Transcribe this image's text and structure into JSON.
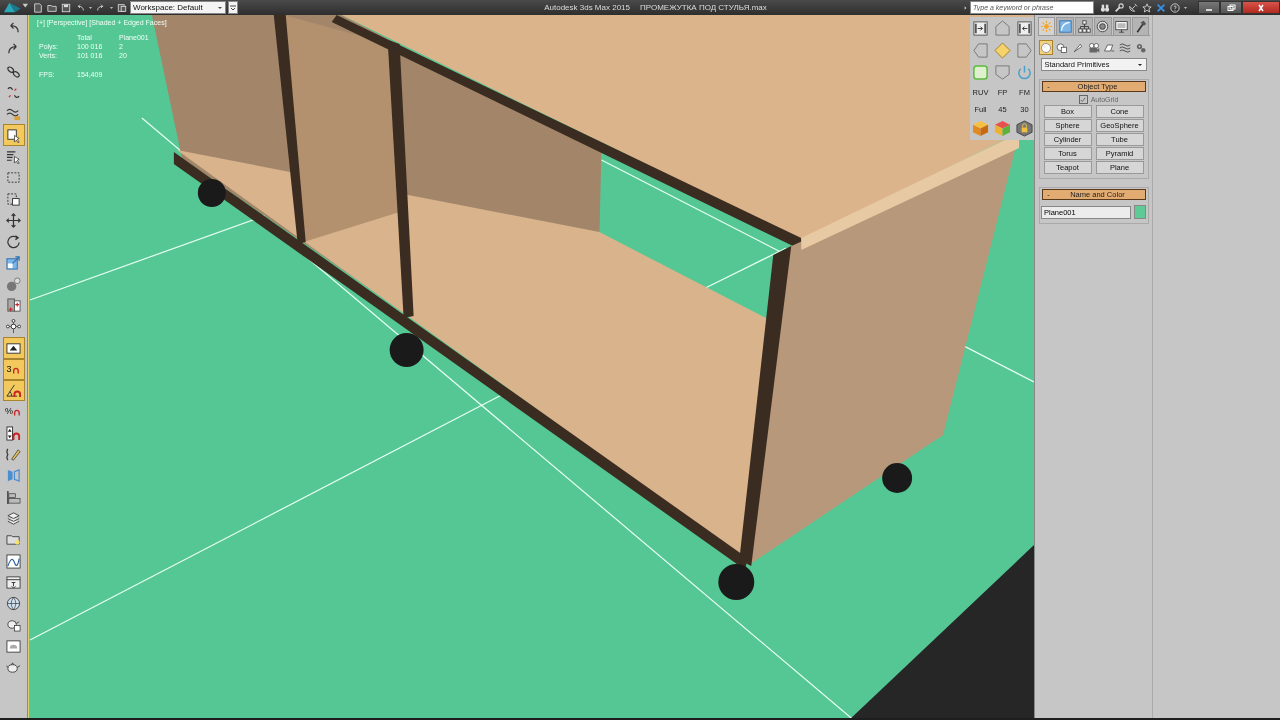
{
  "title_bar": {
    "workspace": "Workspace: Default",
    "app_title": "Autodesk 3ds Max 2015",
    "file_name": "ПРОМЕЖУТКА ПОД СТУЛЬЯ.max",
    "search": {
      "placeholder": "Type a keyword or phrase"
    }
  },
  "left_toolbar": [
    {
      "kind": "undo",
      "active": false
    },
    {
      "kind": "redo",
      "active": false
    },
    {
      "kind": "link",
      "active": false
    },
    {
      "kind": "unlink",
      "active": false
    },
    {
      "kind": "bind",
      "active": false
    },
    {
      "kind": "select",
      "active": true
    },
    {
      "kind": "select_name",
      "active": false
    },
    {
      "kind": "region",
      "active": false
    },
    {
      "kind": "crossing",
      "active": false
    },
    {
      "kind": "move",
      "active": false
    },
    {
      "kind": "rotate",
      "active": false
    },
    {
      "kind": "scale",
      "active": false
    },
    {
      "kind": "place",
      "active": false
    },
    {
      "kind": "manipulate",
      "active": false
    },
    {
      "kind": "pivot",
      "active": false
    },
    {
      "kind": "keyboard",
      "active": true
    },
    {
      "kind": "snap",
      "label": "3",
      "active": true
    },
    {
      "kind": "angle",
      "active": true
    },
    {
      "kind": "percent",
      "label": "%",
      "active": false
    },
    {
      "kind": "spinner",
      "active": false
    },
    {
      "kind": "named",
      "active": false
    },
    {
      "kind": "mirror",
      "active": false
    },
    {
      "kind": "align",
      "active": false
    },
    {
      "kind": "layers",
      "active": false
    },
    {
      "kind": "explorer",
      "active": false
    },
    {
      "kind": "curve",
      "active": false
    },
    {
      "kind": "schematic",
      "active": false
    },
    {
      "kind": "globe",
      "active": false
    },
    {
      "kind": "render_setup",
      "active": false
    },
    {
      "kind": "frame",
      "active": false
    },
    {
      "kind": "render",
      "active": false
    }
  ],
  "viewport": {
    "label": "[+] [Perspective] [Shaded + Edged Faces]",
    "stats": {
      "columns": [
        "Total",
        "Plane001"
      ],
      "rows": [
        {
          "label": "Polys:",
          "total": "100 016",
          "selected": "2"
        },
        {
          "label": "Verts:",
          "total": "101 016",
          "selected": "20"
        }
      ],
      "fps_label": "FPS:",
      "fps": "154,409"
    }
  },
  "nav_toolbar": {
    "labels": [
      "RUV",
      "FP",
      "FM",
      "Full",
      "45",
      "30"
    ]
  },
  "command_panel": {
    "tabs": [
      {
        "kind": "create",
        "selected": true
      },
      {
        "kind": "modify",
        "selected": false
      },
      {
        "kind": "hierarchy",
        "selected": false
      },
      {
        "kind": "motion",
        "selected": false
      },
      {
        "kind": "display",
        "selected": false
      },
      {
        "kind": "utilities",
        "selected": false
      }
    ],
    "categories": [
      {
        "kind": "geometry",
        "selected": true
      },
      {
        "kind": "shapes",
        "selected": false
      },
      {
        "kind": "lights",
        "selected": false
      },
      {
        "kind": "cameras",
        "selected": false
      },
      {
        "kind": "helpers",
        "selected": false
      },
      {
        "kind": "spacewarps",
        "selected": false
      },
      {
        "kind": "systems",
        "selected": false
      }
    ],
    "dropdown": "Standard Primitives",
    "object_type": {
      "toggle": "-",
      "title": "Object Type",
      "autogrid": {
        "label": "AutoGrid",
        "checked": true,
        "disabled": true
      },
      "buttons": [
        "Box",
        "Cone",
        "Sphere",
        "GeoSphere",
        "Cylinder",
        "Tube",
        "Torus",
        "Pyramid",
        "Teapot",
        "Plane"
      ]
    },
    "name_and_color": {
      "toggle": "-",
      "title": "Name and Color",
      "name": "Plane001",
      "color": "#5ecb97"
    }
  }
}
